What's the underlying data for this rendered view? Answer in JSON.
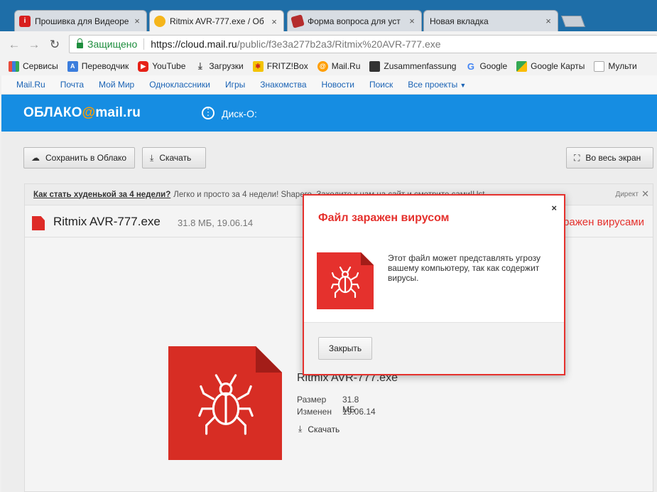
{
  "browser": {
    "tabs": [
      {
        "label": "Прошивка для Видеоре",
        "favicon": "i",
        "favicon_color": "#d81e1e",
        "active": false
      },
      {
        "label": "Ritmix AVR-777.exe / Об",
        "favicon": "cloud",
        "favicon_color": "#f5b51b",
        "active": true
      },
      {
        "label": "Форма вопроса для уст",
        "favicon": "form",
        "favicon_color": "#b52d2d",
        "active": false
      },
      {
        "label": "Новая вкладка",
        "favicon": "",
        "favicon_color": "",
        "active": false
      }
    ],
    "secure_label": "Защищено",
    "url_host": "https://cloud.mail.ru",
    "url_path": "/public/f3e3a277b2a3/Ritmix%20AVR-777.exe"
  },
  "bookmarks": [
    {
      "label": "Сервисы",
      "icon": "apps-icon",
      "color": "#e84c3d"
    },
    {
      "label": "Переводчик",
      "icon": "translate-icon",
      "color": "#3b7ddd"
    },
    {
      "label": "YouTube",
      "icon": "youtube-icon",
      "color": "#e62117"
    },
    {
      "label": "Загрузки",
      "icon": "download-icon",
      "color": "#555555"
    },
    {
      "label": "FRITZ!Box",
      "icon": "fritz-icon",
      "color": "#d0281d"
    },
    {
      "label": "Mail.Ru",
      "icon": "mailru-icon",
      "color": "#168de2"
    },
    {
      "label": "Zusammenfassung",
      "icon": "summary-icon",
      "color": "#333333"
    },
    {
      "label": "Google",
      "icon": "google-icon",
      "color": "#4285f4"
    },
    {
      "label": "Google Карты",
      "icon": "maps-icon",
      "color": "#34a853"
    },
    {
      "label": "Мульти",
      "icon": "page-icon",
      "color": "#888888"
    }
  ],
  "portal": {
    "links": [
      "Mail.Ru",
      "Почта",
      "Мой Мир",
      "Одноклассники",
      "Игры",
      "Знакомства",
      "Новости",
      "Поиск",
      "Все проекты"
    ]
  },
  "header": {
    "logo_left": "ОБЛАКО",
    "logo_at": "@",
    "logo_right": "mail.ru",
    "disk_name": "Диск-О:"
  },
  "toolbar": {
    "save_label": "Сохранить в Облако",
    "download_label": "Скачать",
    "fullscreen_label": "Во весь экран"
  },
  "ad": {
    "link": "Как стать худенькой за 4 недели?",
    "text": "Легко и просто за 4 недели! Shapero. Заходите к нам на сайт и смотрите сами!Ust",
    "label": "Директ",
    "close": "✕"
  },
  "file": {
    "name": "Ritmix AVR-777.exe",
    "size_date": "31.8 МБ, 19.06.14",
    "warning": "Заражен вирусами",
    "size_label": "Размер",
    "size_value": "31.8 МБ",
    "modified_label": "Изменен",
    "modified_value": "19.06.14",
    "download_label": "Скачать"
  },
  "modal": {
    "title": "Файл заражен вирусом",
    "text": "Этот файл может представлять угрозу вашему компьютеру, так как содержит вирусы.",
    "close_label": "Закрыть",
    "close_x": "×"
  },
  "colors": {
    "brand_blue": "#168de2",
    "danger": "#e5312d"
  }
}
